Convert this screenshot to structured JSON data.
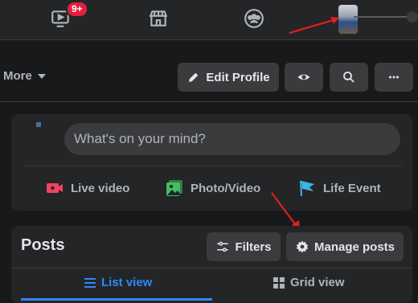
{
  "topnav": {
    "items": [
      {
        "icon": "watch-icon",
        "badge": "9+"
      },
      {
        "icon": "marketplace-icon"
      },
      {
        "icon": "groups-icon"
      },
      {
        "icon": "profile-avatar"
      }
    ]
  },
  "profile_actions": {
    "more_label": "More",
    "edit_profile_label": "Edit Profile"
  },
  "composer": {
    "placeholder": "What's on your mind?",
    "actions": [
      {
        "label": "Live video",
        "icon": "live-video-icon",
        "color": "#f3425f"
      },
      {
        "label": "Photo/Video",
        "icon": "photo-video-icon",
        "color": "#45bd62"
      },
      {
        "label": "Life Event",
        "icon": "life-event-flag-icon",
        "color": "#3eb3e6"
      }
    ]
  },
  "posts": {
    "title": "Posts",
    "filters_label": "Filters",
    "manage_label": "Manage posts",
    "tabs": [
      {
        "label": "List view",
        "active": true
      },
      {
        "label": "Grid view",
        "active": false
      }
    ]
  },
  "colors": {
    "accent": "#2d88ff",
    "annotation_arrow": "#e02020",
    "badge": "#e41e3f"
  }
}
